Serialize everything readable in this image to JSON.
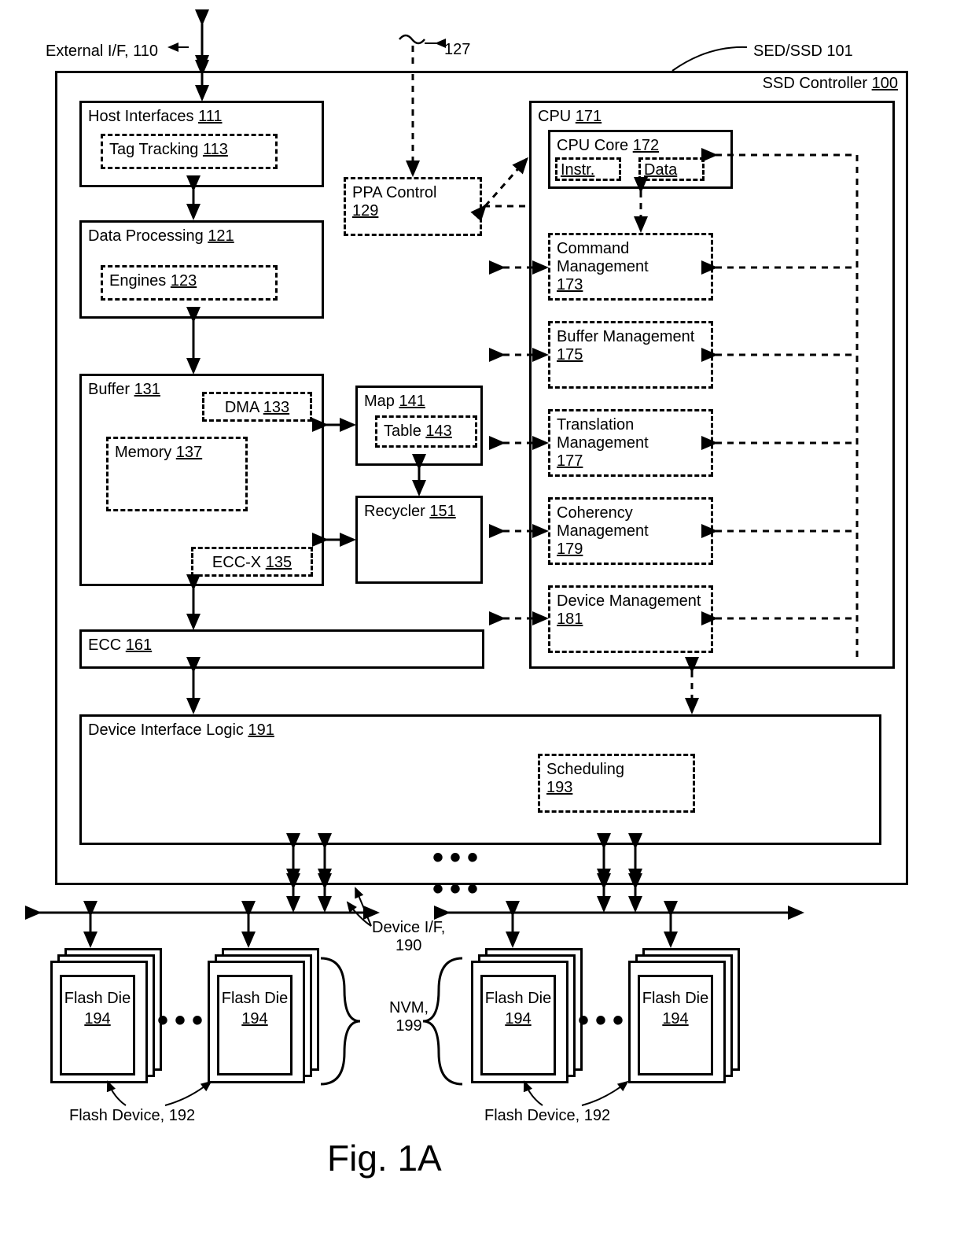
{
  "labels": {
    "externalIF": "External I/F, 110",
    "sedSsd": "SED/SSD 101",
    "ssdController": "SSD Controller",
    "ssdControllerNum": "100",
    "hostInterfaces": "Host Interfaces",
    "hostInterfacesNum": "111",
    "tagTracking": "Tag Tracking",
    "tagTrackingNum": "113",
    "dataProcessing": "Data Processing",
    "dataProcessingNum": "121",
    "engines": "Engines",
    "enginesNum": "123",
    "ppaControl": "PPA Control",
    "ppaControlNum": "129",
    "ppaArrow": "127",
    "buffer": "Buffer",
    "bufferNum": "131",
    "dma": "DMA",
    "dmaNum": "133",
    "memory": "Memory",
    "memoryNum": "137",
    "eccx": "ECC-X",
    "eccxNum": "135",
    "map": "Map",
    "mapNum": "141",
    "table": "Table",
    "tableNum": "143",
    "recycler": "Recycler",
    "recyclerNum": "151",
    "ecc": "ECC",
    "eccNum": "161",
    "deviceInterfaceLogic": "Device Interface Logic",
    "deviceInterfaceLogicNum": "191",
    "scheduling": "Scheduling",
    "schedulingNum": "193",
    "cpu": "CPU",
    "cpuNum": "171",
    "cpuCore": "CPU Core",
    "cpuCoreNum": "172",
    "instr": "Instr.",
    "data": "Data",
    "commandMgmt": "Command Management",
    "commandMgmtNum": "173",
    "bufferMgmt": "Buffer Management",
    "bufferMgmtNum": "175",
    "translationMgmt": "Translation Management",
    "translationMgmtNum": "177",
    "coherencyMgmt": "Coherency Management",
    "coherencyMgmtNum": "179",
    "deviceMgmt": "Device Management",
    "deviceMgmtNum": "181",
    "deviceIF": "Device I/F,",
    "deviceIFNum": "190",
    "nvm": "NVM,",
    "nvmNum": "199",
    "flashDie": "Flash Die",
    "flashDieNum": "194",
    "flashDevice": "Flash Device, 192",
    "figure": "Fig. 1A"
  }
}
